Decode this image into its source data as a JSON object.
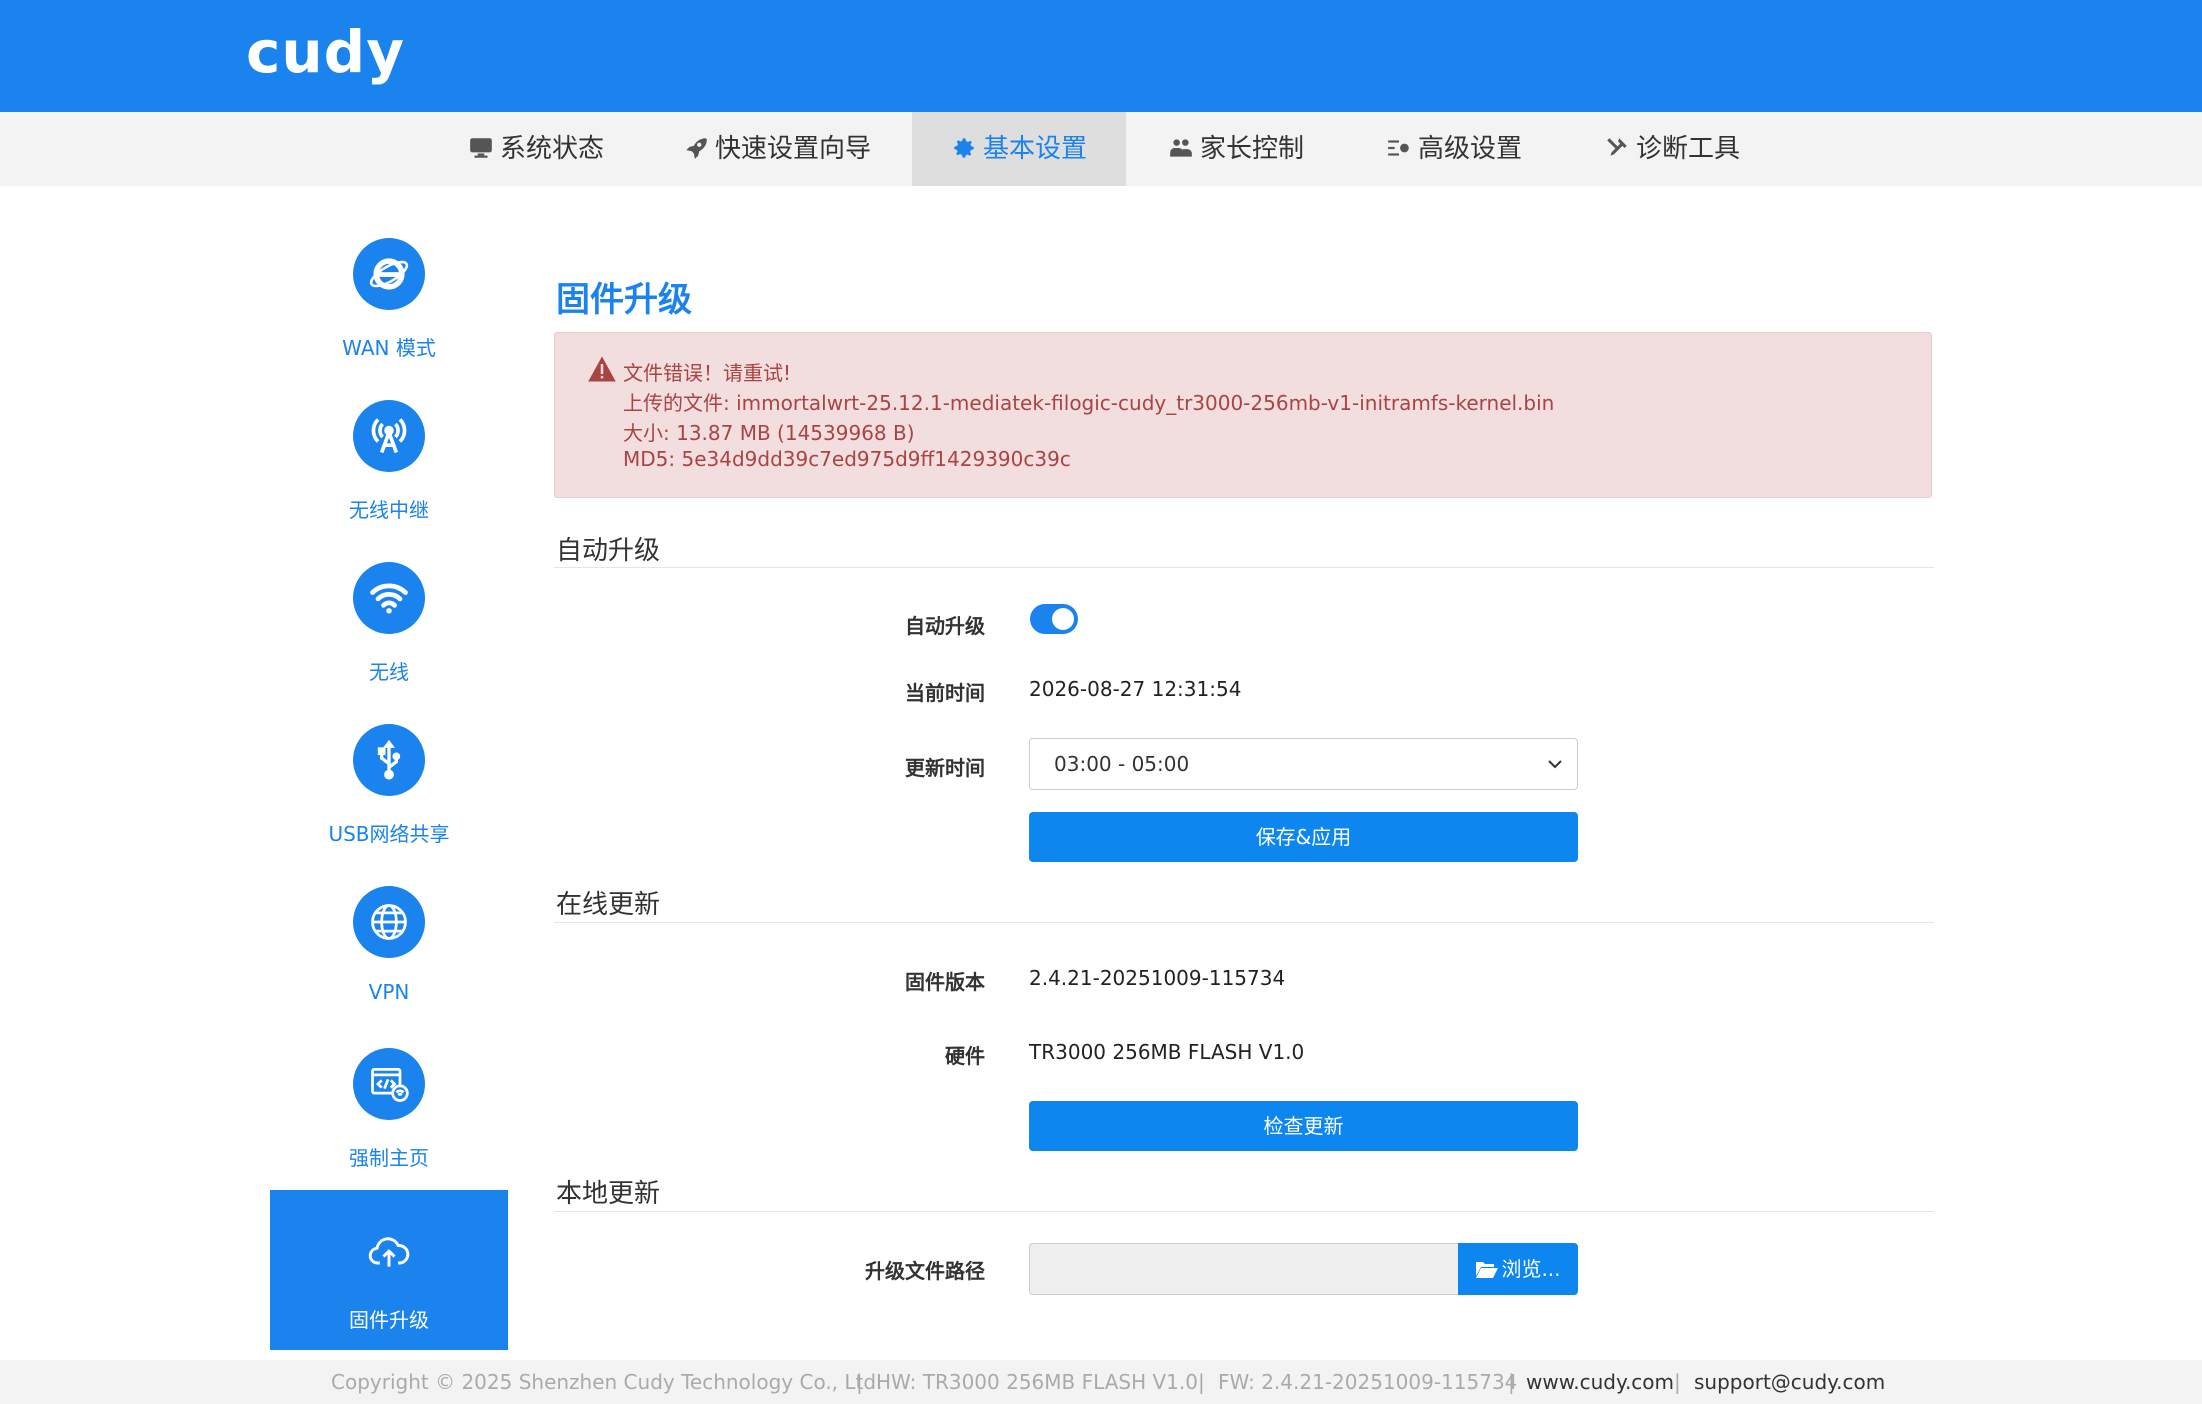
{
  "header": {
    "logo": "cudy"
  },
  "nav": {
    "items": [
      {
        "label": "系统状态",
        "icon": "monitor-icon"
      },
      {
        "label": "快速设置向导",
        "icon": "rocket-icon"
      },
      {
        "label": "基本设置",
        "icon": "gear-icon",
        "active": true
      },
      {
        "label": "家长控制",
        "icon": "users-icon"
      },
      {
        "label": "高级设置",
        "icon": "sliders-icon"
      },
      {
        "label": "诊断工具",
        "icon": "tools-icon"
      }
    ]
  },
  "sidebar": {
    "items": [
      {
        "label": "WAN 模式",
        "icon": "internet-explorer-icon"
      },
      {
        "label": "无线中继",
        "icon": "antenna-icon"
      },
      {
        "label": "无线",
        "icon": "wifi-icon"
      },
      {
        "label": "USB网络共享",
        "icon": "usb-icon"
      },
      {
        "label": "VPN",
        "icon": "globe-icon"
      },
      {
        "label": "强制主页",
        "icon": "portal-icon"
      },
      {
        "label": "固件升级",
        "icon": "cloud-upload-icon",
        "active": true
      }
    ]
  },
  "main": {
    "title": "固件升级",
    "alert": {
      "line1": "文件错误！请重试!",
      "line2": "上传的文件: immortalwrt-25.12.1-mediatek-filogic-cudy_tr3000-256mb-v1-initramfs-kernel.bin",
      "line3": "大小: 13.87 MB (14539968 B)",
      "line4": "MD5: 5e34d9dd39c7ed975d9ff1429390c39c"
    },
    "auto_upgrade": {
      "section_title": "自动升级",
      "toggle_label": "自动升级",
      "toggle_on": true,
      "current_time_label": "当前时间",
      "current_time": "2026-08-27 12:31:54",
      "update_time_label": "更新时间",
      "update_time_value": "03:00 - 05:00",
      "save_label": "保存&应用"
    },
    "online_update": {
      "section_title": "在线更新",
      "firmware_label": "固件版本",
      "firmware_value": "2.4.21-20251009-115734",
      "hardware_label": "硬件",
      "hardware_value": "TR3000 256MB FLASH V1.0",
      "check_label": "检查更新"
    },
    "local_update": {
      "section_title": "本地更新",
      "path_label": "升级文件路径",
      "browse_label": "浏览..."
    }
  },
  "footer": {
    "copyright": "Copyright © 2025 Shenzhen Cudy Technology Co., Ltd.",
    "hw": "HW: TR3000 256MB FLASH V1.0",
    "fw": "FW: 2.4.21-20251009-115734",
    "website": "www.cudy.com",
    "email": "support@cudy.com",
    "separator": "|"
  },
  "colors": {
    "brand": "#1a83ee",
    "button": "#0d86f0",
    "alert_bg": "#f2dedf",
    "alert_text": "#a94442"
  }
}
